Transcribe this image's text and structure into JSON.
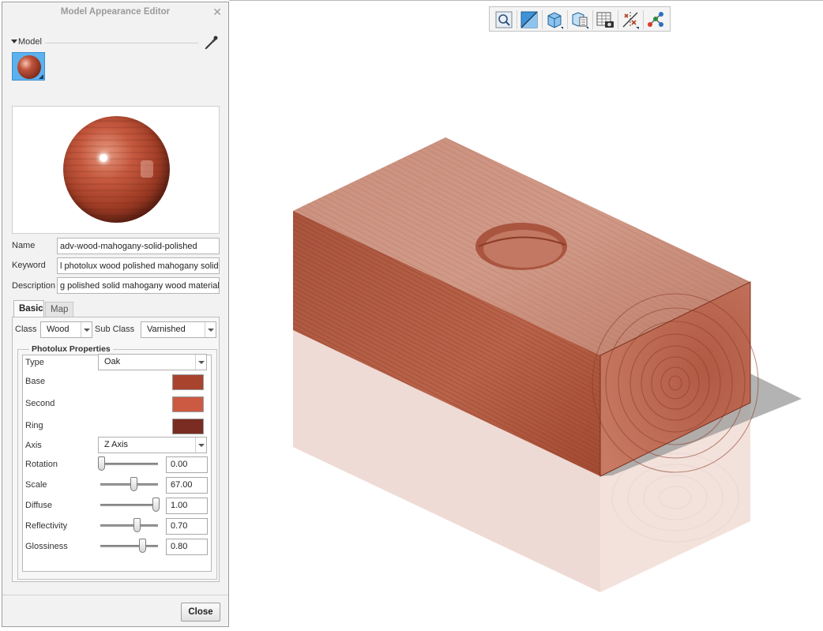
{
  "dialog": {
    "title": "Model Appearance Editor",
    "close_glyph": "✕",
    "model_section_label": "Model",
    "fields": {
      "name_label": "Name",
      "name_value": "adv-wood-mahogany-solid-polished",
      "keyword_label": "Keyword",
      "keyword_value": "l photolux wood polished mahogany solid",
      "description_label": "Description",
      "description_value": "g polished solid mahogany wood material"
    },
    "tabs": [
      "Basic",
      "Map"
    ],
    "class_label": "Class",
    "class_value": "Wood",
    "subclass_label": "Sub Class",
    "subclass_value": "Varnished",
    "group_title": "Photolux Properties",
    "type_label": "Type",
    "type_value": "Oak",
    "colors": {
      "base_label": "Base",
      "base_color": "#a8432e",
      "second_label": "Second",
      "second_color": "#cc5a42",
      "ring_label": "Ring",
      "ring_color": "#7a2c22"
    },
    "axis_label": "Axis",
    "axis_value": "Z Axis",
    "sliders": [
      {
        "label": "Rotation",
        "value": "0.00",
        "level": 0.0
      },
      {
        "label": "Scale",
        "value": "67.00",
        "level": 0.6
      },
      {
        "label": "Diffuse",
        "value": "1.00",
        "level": 1.0
      },
      {
        "label": "Reflectivity",
        "value": "0.70",
        "level": 0.65
      },
      {
        "label": "Glossiness",
        "value": "0.80",
        "level": 0.75
      }
    ],
    "close_button": "Close"
  },
  "toolbar": {
    "icons": [
      "zoom-icon",
      "section-icon",
      "view-cube-icon",
      "saved-views-icon",
      "render-table-icon",
      "datum-display-icon",
      "connector-icon"
    ]
  }
}
